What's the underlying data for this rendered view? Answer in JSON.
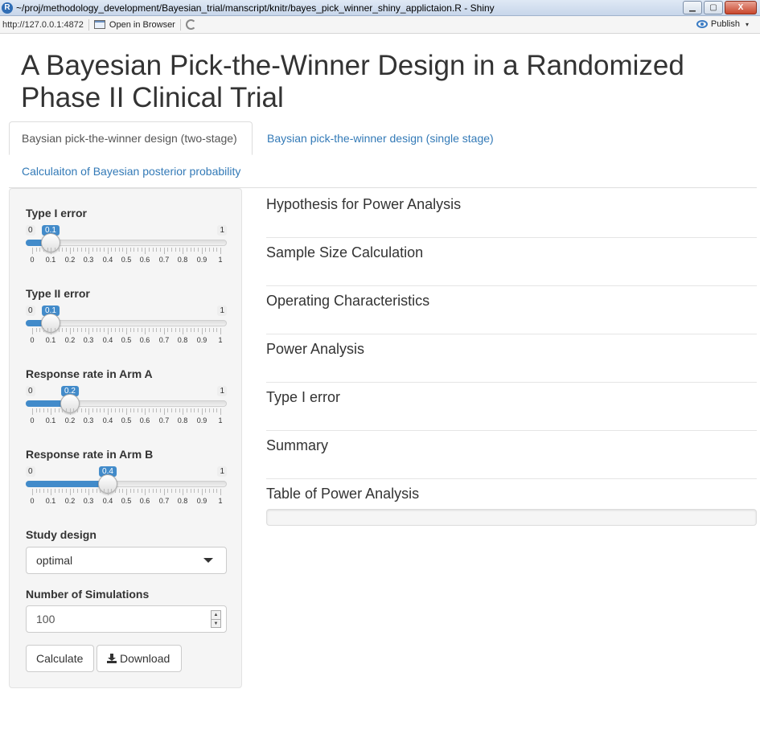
{
  "window": {
    "app_icon_letter": "R",
    "title": "~/proj/methodology_development/Bayesian_trial/manscript/knitr/bayes_pick_winner_shiny_applictaion.R - Shiny",
    "controls": {
      "minimize": "▁",
      "maximize": "▢",
      "close": "X"
    }
  },
  "toolbar": {
    "url": "http://127.0.0.1:4872",
    "open_in_browser": "Open in Browser",
    "publish": "Publish",
    "publish_caret": "▾"
  },
  "page": {
    "title": "A Bayesian Pick-the-Winner Design in a Randomized Phase II Clinical Trial"
  },
  "tabs": [
    {
      "label": "Baysian pick-the-winner design (two-stage)",
      "active": true
    },
    {
      "label": "Baysian pick-the-winner design (single stage)",
      "active": false
    },
    {
      "label": "Calculaiton of Bayesian posterior probability",
      "active": false
    }
  ],
  "sidebar": {
    "sliders": [
      {
        "label": "Type I error",
        "min": "0",
        "max": "1",
        "value": 0.1,
        "value_label": "0.1"
      },
      {
        "label": "Type II error",
        "min": "0",
        "max": "1",
        "value": 0.1,
        "value_label": "0.1"
      },
      {
        "label": "Response rate in Arm A",
        "min": "0",
        "max": "1",
        "value": 0.2,
        "value_label": "0.2"
      },
      {
        "label": "Response rate in Arm B",
        "min": "0",
        "max": "1",
        "value": 0.4,
        "value_label": "0.4"
      }
    ],
    "tick_labels": [
      "0",
      "0.1",
      "0.2",
      "0.3",
      "0.4",
      "0.5",
      "0.6",
      "0.7",
      "0.8",
      "0.9",
      "1"
    ],
    "study_design": {
      "label": "Study design",
      "value": "optimal"
    },
    "simulations": {
      "label": "Number of Simulations",
      "value": "100",
      "up": "▲",
      "down": "▼"
    },
    "buttons": {
      "calculate": "Calculate",
      "download": "Download"
    }
  },
  "main": {
    "sections": [
      "Hypothesis for Power Analysis",
      "Sample Size Calculation",
      "Operating Characteristics",
      "Power Analysis",
      "Type I error",
      "Summary",
      "Table of Power Analysis"
    ]
  },
  "colors": {
    "accent": "#428bca",
    "link": "#337ab7",
    "panel": "#f5f5f5"
  }
}
